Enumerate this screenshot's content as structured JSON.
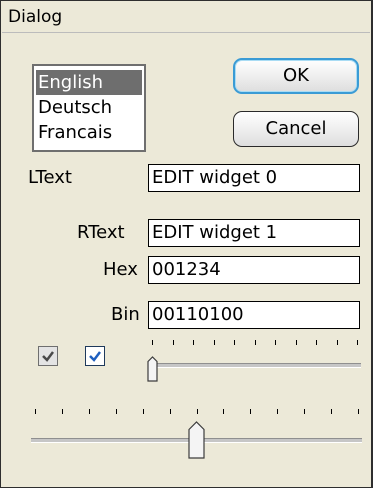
{
  "window": {
    "title": "Dialog"
  },
  "languages": {
    "items": [
      "English",
      "Deutsch",
      "Francais"
    ],
    "selected": "English"
  },
  "buttons": {
    "ok": "OK",
    "cancel": "Cancel"
  },
  "fields": [
    {
      "label": "LText",
      "value": "EDIT widget 0"
    },
    {
      "label": "RText",
      "value": "EDIT widget 1"
    },
    {
      "label": "Hex",
      "value": "001234"
    },
    {
      "label": "Bin",
      "value": "00110100"
    }
  ],
  "checkboxes": [
    {
      "checked": true
    },
    {
      "checked": true
    }
  ],
  "sliders": {
    "small": {
      "position": 0.0,
      "ticks": 11
    },
    "large": {
      "position": 0.5,
      "ticks": 13
    }
  },
  "colors": {
    "accent": "#3a9bd5",
    "checkmark": "#1f5fbf",
    "selection": "#6e6e6e"
  }
}
